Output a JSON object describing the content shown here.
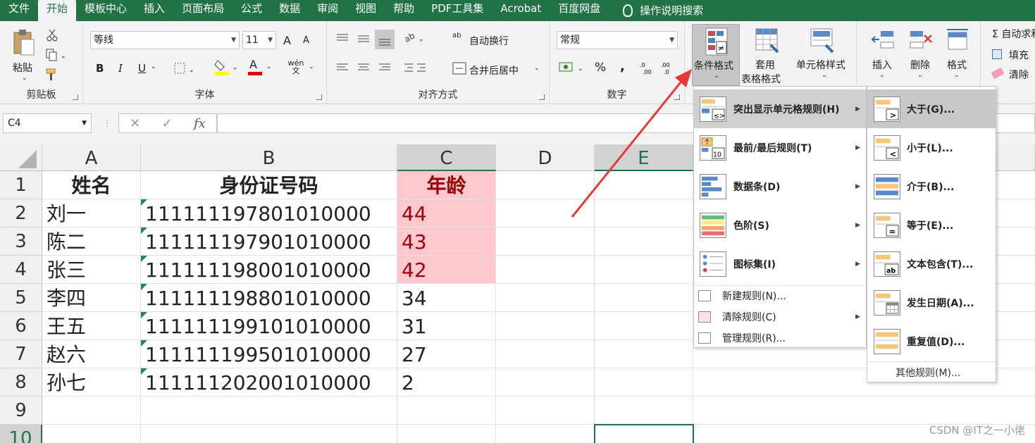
{
  "menubar": {
    "tabs": [
      "文件",
      "开始",
      "模板中心",
      "插入",
      "页面布局",
      "公式",
      "数据",
      "审阅",
      "视图",
      "帮助",
      "PDF工具集",
      "Acrobat",
      "百度网盘"
    ],
    "active_tab": "开始",
    "search_label": "操作说明搜索"
  },
  "ribbon": {
    "clipboard": {
      "label": "剪贴板",
      "paste": "粘贴"
    },
    "font": {
      "label": "字体",
      "font_name": "等线",
      "font_size": "11",
      "bold": "B",
      "italic": "I",
      "underline": "U",
      "grow": "A",
      "shrink": "A",
      "phonetic": "wén 文",
      "font_color_letter": "A"
    },
    "alignment": {
      "label": "对齐方式",
      "wrap_text": "自动换行",
      "merge_center": "合并后居中",
      "wrap_icon_text": "ab"
    },
    "number": {
      "label": "数字",
      "format": "常规",
      "percent": "%",
      "comma": ","
    },
    "styles": {
      "conditional_formatting": "条件格式",
      "format_as_table_line1": "套用",
      "format_as_table_line2": "表格格式",
      "cell_styles": "单元格样式"
    },
    "cells": {
      "insert": "插入",
      "delete": "删除",
      "format": "格式"
    },
    "editing": {
      "autosum": "自动求和",
      "fill": "填充",
      "clear": "清除",
      "sigma": "Σ"
    }
  },
  "formula_bar": {
    "name_box": "C4",
    "fx": "fx",
    "cancel": "✕",
    "enter": "✓",
    "content": ""
  },
  "sheet": {
    "columns": [
      "A",
      "B",
      "C",
      "D",
      "E"
    ],
    "rows": [
      "1",
      "2",
      "3",
      "4",
      "5",
      "6",
      "7",
      "8",
      "9",
      "10"
    ],
    "header": {
      "name": "姓名",
      "id": "身份证号码",
      "age": "年龄"
    },
    "data": [
      {
        "name": "刘一",
        "id": "111111197801010000",
        "age": "44"
      },
      {
        "name": "陈二",
        "id": "111111197901010000",
        "age": "43"
      },
      {
        "name": "张三",
        "id": "111111198001010000",
        "age": "42"
      },
      {
        "name": "李四",
        "id": "111111198801010000",
        "age": "34"
      },
      {
        "name": "王五",
        "id": "111111199101010000",
        "age": "31"
      },
      {
        "name": "赵六",
        "id": "111111199501010000",
        "age": "27"
      },
      {
        "name": "孙七",
        "id": "111111202001010000",
        "age": "2"
      }
    ]
  },
  "cf_menu": {
    "items": [
      {
        "label": "突出显示单元格规则(H)",
        "icon": "highlight-cells-icon"
      },
      {
        "label": "最前/最后规则(T)",
        "icon": "top-bottom-icon"
      },
      {
        "label": "数据条(D)",
        "icon": "data-bars-icon"
      },
      {
        "label": "色阶(S)",
        "icon": "color-scales-icon"
      },
      {
        "label": "图标集(I)",
        "icon": "icon-sets-icon"
      }
    ],
    "small_items": [
      {
        "label": "新建规则(N)...",
        "icon": "new-rule-icon"
      },
      {
        "label": "清除规则(C)",
        "icon": "clear-rules-icon"
      },
      {
        "label": "管理规则(R)...",
        "icon": "manage-rules-icon"
      }
    ]
  },
  "submenu": {
    "items": [
      {
        "label": "大于(G)...",
        "glyph": ">"
      },
      {
        "label": "小于(L)...",
        "glyph": "<"
      },
      {
        "label": "介于(B)...",
        "glyph": ""
      },
      {
        "label": "等于(E)...",
        "glyph": "="
      },
      {
        "label": "文本包含(T)...",
        "glyph": "ab"
      },
      {
        "label": "发生日期(A)...",
        "glyph": ""
      },
      {
        "label": "重复值(D)...",
        "glyph": ""
      }
    ],
    "more": "其他规则(M)..."
  },
  "top_bottom_icon_number": "10",
  "watermark": "CSDN @IT之一小佬",
  "colors": {
    "excel_green": "#217346",
    "highlight_fill": "#ffc7ce",
    "highlight_text": "#9c0006",
    "arrow": "#e53935",
    "font_color_bar": "#e00000",
    "fill_color_bar": "#ffff00"
  }
}
